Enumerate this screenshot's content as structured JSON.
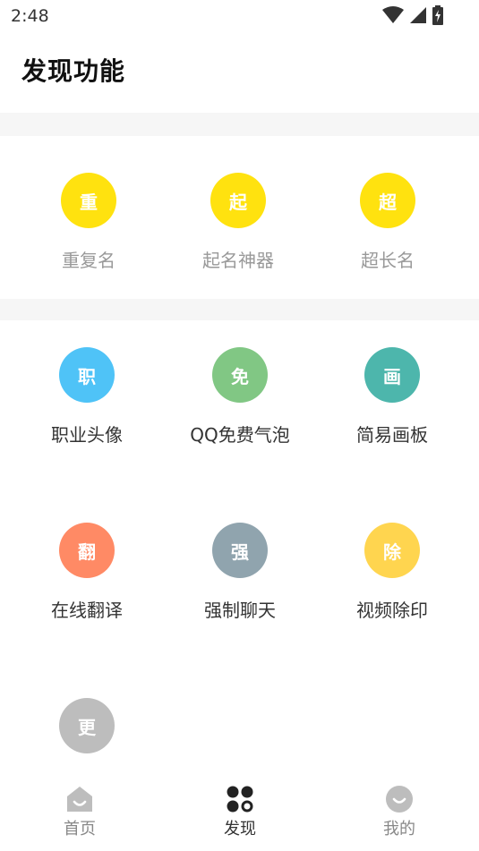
{
  "status_bar": {
    "time": "2:48",
    "icons": [
      "wifi-icon",
      "signal-icon",
      "battery-charging-icon"
    ]
  },
  "page": {
    "title": "发现功能"
  },
  "sections": [
    {
      "items": [
        {
          "glyph": "重",
          "label": "重复名",
          "color": "#FFE20F"
        },
        {
          "glyph": "起",
          "label": "起名神器",
          "color": "#FFE20F"
        },
        {
          "glyph": "超",
          "label": "超长名",
          "color": "#FFE20F"
        }
      ]
    },
    {
      "items": [
        {
          "glyph": "职",
          "label": "职业头像",
          "color": "#4FC3F7"
        },
        {
          "glyph": "免",
          "label": "QQ免费气泡",
          "color": "#81C784"
        },
        {
          "glyph": "画",
          "label": "简易画板",
          "color": "#4DB6AC"
        },
        {
          "glyph": "翻",
          "label": "在线翻译",
          "color": "#FF8A65"
        },
        {
          "glyph": "强",
          "label": "强制聊天",
          "color": "#90A4AE"
        },
        {
          "glyph": "除",
          "label": "视频除印",
          "color": "#FFD54F"
        },
        {
          "glyph": "更",
          "label": "",
          "color": "#BDBDBD"
        }
      ]
    }
  ],
  "bottom_nav": {
    "items": [
      {
        "label": "首页",
        "icon": "home-icon",
        "active": false
      },
      {
        "label": "发现",
        "icon": "discover-icon",
        "active": true
      },
      {
        "label": "我的",
        "icon": "profile-icon",
        "active": false
      }
    ]
  },
  "colors": {
    "active_nav": "#222222",
    "inactive_nav": "#BDBDBD",
    "band": "#F6F6F6"
  }
}
